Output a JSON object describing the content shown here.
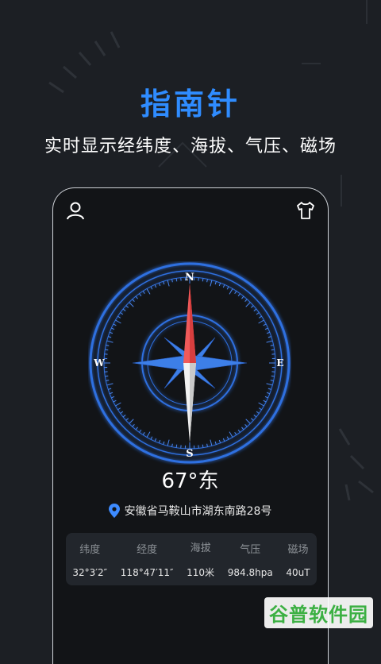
{
  "header": {
    "title": "指南针",
    "subtitle": "实时显示经纬度、海拔、气压、磁场"
  },
  "colors": {
    "accent": "#2f8cff",
    "background": "#1c1f24",
    "needle_north": "#f05a5a",
    "compass_blue": "#2f6fe0"
  },
  "icons": {
    "profile": "user-icon",
    "skin": "shirt-icon",
    "location": "pin-icon"
  },
  "compass": {
    "north": "N",
    "east": "E",
    "south": "S",
    "west": "W",
    "heading_text": "67°东"
  },
  "location": {
    "address": "安徽省马鞍山市湖东南路28号"
  },
  "stats": [
    {
      "label": "纬度",
      "value": "32°3′2″"
    },
    {
      "label": "经度",
      "value": "118°47′11″"
    },
    {
      "label": "海拔",
      "value": "110米"
    },
    {
      "label": "气压",
      "value": "984.8hpa"
    },
    {
      "label": "磁场",
      "value": "40uT"
    }
  ],
  "watermark": "谷普软件园"
}
